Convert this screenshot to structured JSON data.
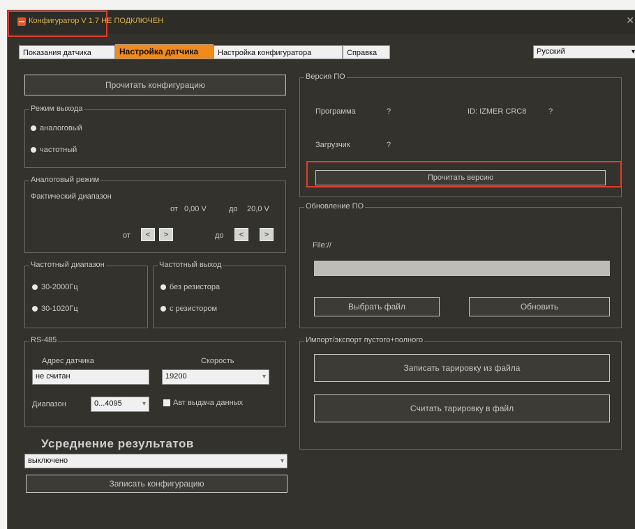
{
  "window": {
    "title": "Конфигуратор V 1.7",
    "status": "НЕ ПОДКЛЮЧЕН"
  },
  "tabs": [
    {
      "label": "Показания датчика"
    },
    {
      "label": "Настройка датчика"
    },
    {
      "label": "Настройка конфигуратора"
    },
    {
      "label": "Справка"
    }
  ],
  "language": {
    "selected": "Русский"
  },
  "left": {
    "read_config_button": "Прочитать конфигурацию",
    "output_mode": {
      "legend": "Режим выхода",
      "options": [
        "аналоговый",
        "частотный"
      ]
    },
    "analog_mode": {
      "legend": "Аналоговый режим",
      "actual_range_label": "Фактический диапазон",
      "from_label": "от",
      "from_value": "0,00 V",
      "to_label": "до",
      "to_value": "20,0 V",
      "adj_from_label": "от",
      "adj_to_label": "до",
      "decrease": "<",
      "increase": ">"
    },
    "freq_range": {
      "legend": "Частотный диапазон",
      "options": [
        "30-2000Гц",
        "30-1020Гц"
      ]
    },
    "freq_output": {
      "legend": "Частотный выход",
      "options": [
        "без резистора",
        "с резистором"
      ]
    },
    "rs485": {
      "legend": "RS-485",
      "address_label": "Адрес датчика",
      "address_value": "не считан",
      "speed_label": "Скорость",
      "speed_value": "19200",
      "range_label": "Диапазон",
      "range_value": "0...4095",
      "auto_send_label": "Авт выдача данных"
    },
    "averaging": {
      "heading": "Усреднение результатов",
      "value": "выключено"
    },
    "write_config_button": "Записать конфигурацию"
  },
  "right": {
    "version": {
      "legend": "Версия ПО",
      "program_label": "Программа",
      "program_value": "?",
      "id_label": "ID: IZMER CRC8",
      "id_value": "?",
      "loader_label": "Загрузчик",
      "loader_value": "?",
      "read_version_button": "Прочитать версию"
    },
    "update": {
      "legend": "Обновление ПО",
      "file_label": "File://",
      "progress": 0,
      "choose_file_button": "Выбрать файл",
      "update_button": "Обновить"
    },
    "import_export": {
      "legend": "Импорт/экспорт пустого+полного",
      "write_button": "Записать тарировку из файла",
      "read_button": "Считать тарировку в файл"
    }
  }
}
